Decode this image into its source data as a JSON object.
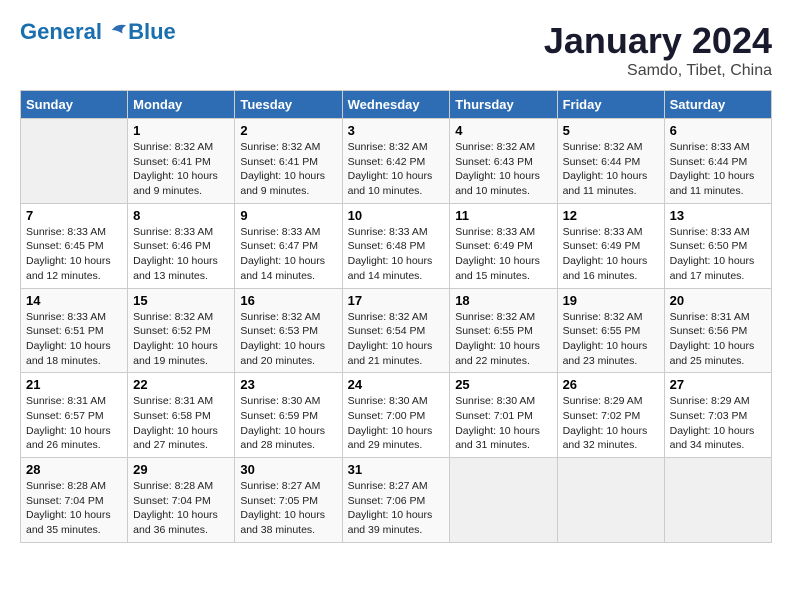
{
  "header": {
    "logo_line1": "General",
    "logo_line2": "Blue",
    "month_year": "January 2024",
    "location": "Samdo, Tibet, China"
  },
  "columns": [
    "Sunday",
    "Monday",
    "Tuesday",
    "Wednesday",
    "Thursday",
    "Friday",
    "Saturday"
  ],
  "weeks": [
    [
      {
        "day": "",
        "content": ""
      },
      {
        "day": "1",
        "content": "Sunrise: 8:32 AM\nSunset: 6:41 PM\nDaylight: 10 hours\nand 9 minutes."
      },
      {
        "day": "2",
        "content": "Sunrise: 8:32 AM\nSunset: 6:41 PM\nDaylight: 10 hours\nand 9 minutes."
      },
      {
        "day": "3",
        "content": "Sunrise: 8:32 AM\nSunset: 6:42 PM\nDaylight: 10 hours\nand 10 minutes."
      },
      {
        "day": "4",
        "content": "Sunrise: 8:32 AM\nSunset: 6:43 PM\nDaylight: 10 hours\nand 10 minutes."
      },
      {
        "day": "5",
        "content": "Sunrise: 8:32 AM\nSunset: 6:44 PM\nDaylight: 10 hours\nand 11 minutes."
      },
      {
        "day": "6",
        "content": "Sunrise: 8:33 AM\nSunset: 6:44 PM\nDaylight: 10 hours\nand 11 minutes."
      }
    ],
    [
      {
        "day": "7",
        "content": "Sunrise: 8:33 AM\nSunset: 6:45 PM\nDaylight: 10 hours\nand 12 minutes."
      },
      {
        "day": "8",
        "content": "Sunrise: 8:33 AM\nSunset: 6:46 PM\nDaylight: 10 hours\nand 13 minutes."
      },
      {
        "day": "9",
        "content": "Sunrise: 8:33 AM\nSunset: 6:47 PM\nDaylight: 10 hours\nand 14 minutes."
      },
      {
        "day": "10",
        "content": "Sunrise: 8:33 AM\nSunset: 6:48 PM\nDaylight: 10 hours\nand 14 minutes."
      },
      {
        "day": "11",
        "content": "Sunrise: 8:33 AM\nSunset: 6:49 PM\nDaylight: 10 hours\nand 15 minutes."
      },
      {
        "day": "12",
        "content": "Sunrise: 8:33 AM\nSunset: 6:49 PM\nDaylight: 10 hours\nand 16 minutes."
      },
      {
        "day": "13",
        "content": "Sunrise: 8:33 AM\nSunset: 6:50 PM\nDaylight: 10 hours\nand 17 minutes."
      }
    ],
    [
      {
        "day": "14",
        "content": "Sunrise: 8:33 AM\nSunset: 6:51 PM\nDaylight: 10 hours\nand 18 minutes."
      },
      {
        "day": "15",
        "content": "Sunrise: 8:32 AM\nSunset: 6:52 PM\nDaylight: 10 hours\nand 19 minutes."
      },
      {
        "day": "16",
        "content": "Sunrise: 8:32 AM\nSunset: 6:53 PM\nDaylight: 10 hours\nand 20 minutes."
      },
      {
        "day": "17",
        "content": "Sunrise: 8:32 AM\nSunset: 6:54 PM\nDaylight: 10 hours\nand 21 minutes."
      },
      {
        "day": "18",
        "content": "Sunrise: 8:32 AM\nSunset: 6:55 PM\nDaylight: 10 hours\nand 22 minutes."
      },
      {
        "day": "19",
        "content": "Sunrise: 8:32 AM\nSunset: 6:55 PM\nDaylight: 10 hours\nand 23 minutes."
      },
      {
        "day": "20",
        "content": "Sunrise: 8:31 AM\nSunset: 6:56 PM\nDaylight: 10 hours\nand 25 minutes."
      }
    ],
    [
      {
        "day": "21",
        "content": "Sunrise: 8:31 AM\nSunset: 6:57 PM\nDaylight: 10 hours\nand 26 minutes."
      },
      {
        "day": "22",
        "content": "Sunrise: 8:31 AM\nSunset: 6:58 PM\nDaylight: 10 hours\nand 27 minutes."
      },
      {
        "day": "23",
        "content": "Sunrise: 8:30 AM\nSunset: 6:59 PM\nDaylight: 10 hours\nand 28 minutes."
      },
      {
        "day": "24",
        "content": "Sunrise: 8:30 AM\nSunset: 7:00 PM\nDaylight: 10 hours\nand 29 minutes."
      },
      {
        "day": "25",
        "content": "Sunrise: 8:30 AM\nSunset: 7:01 PM\nDaylight: 10 hours\nand 31 minutes."
      },
      {
        "day": "26",
        "content": "Sunrise: 8:29 AM\nSunset: 7:02 PM\nDaylight: 10 hours\nand 32 minutes."
      },
      {
        "day": "27",
        "content": "Sunrise: 8:29 AM\nSunset: 7:03 PM\nDaylight: 10 hours\nand 34 minutes."
      }
    ],
    [
      {
        "day": "28",
        "content": "Sunrise: 8:28 AM\nSunset: 7:04 PM\nDaylight: 10 hours\nand 35 minutes."
      },
      {
        "day": "29",
        "content": "Sunrise: 8:28 AM\nSunset: 7:04 PM\nDaylight: 10 hours\nand 36 minutes."
      },
      {
        "day": "30",
        "content": "Sunrise: 8:27 AM\nSunset: 7:05 PM\nDaylight: 10 hours\nand 38 minutes."
      },
      {
        "day": "31",
        "content": "Sunrise: 8:27 AM\nSunset: 7:06 PM\nDaylight: 10 hours\nand 39 minutes."
      },
      {
        "day": "",
        "content": ""
      },
      {
        "day": "",
        "content": ""
      },
      {
        "day": "",
        "content": ""
      }
    ]
  ]
}
